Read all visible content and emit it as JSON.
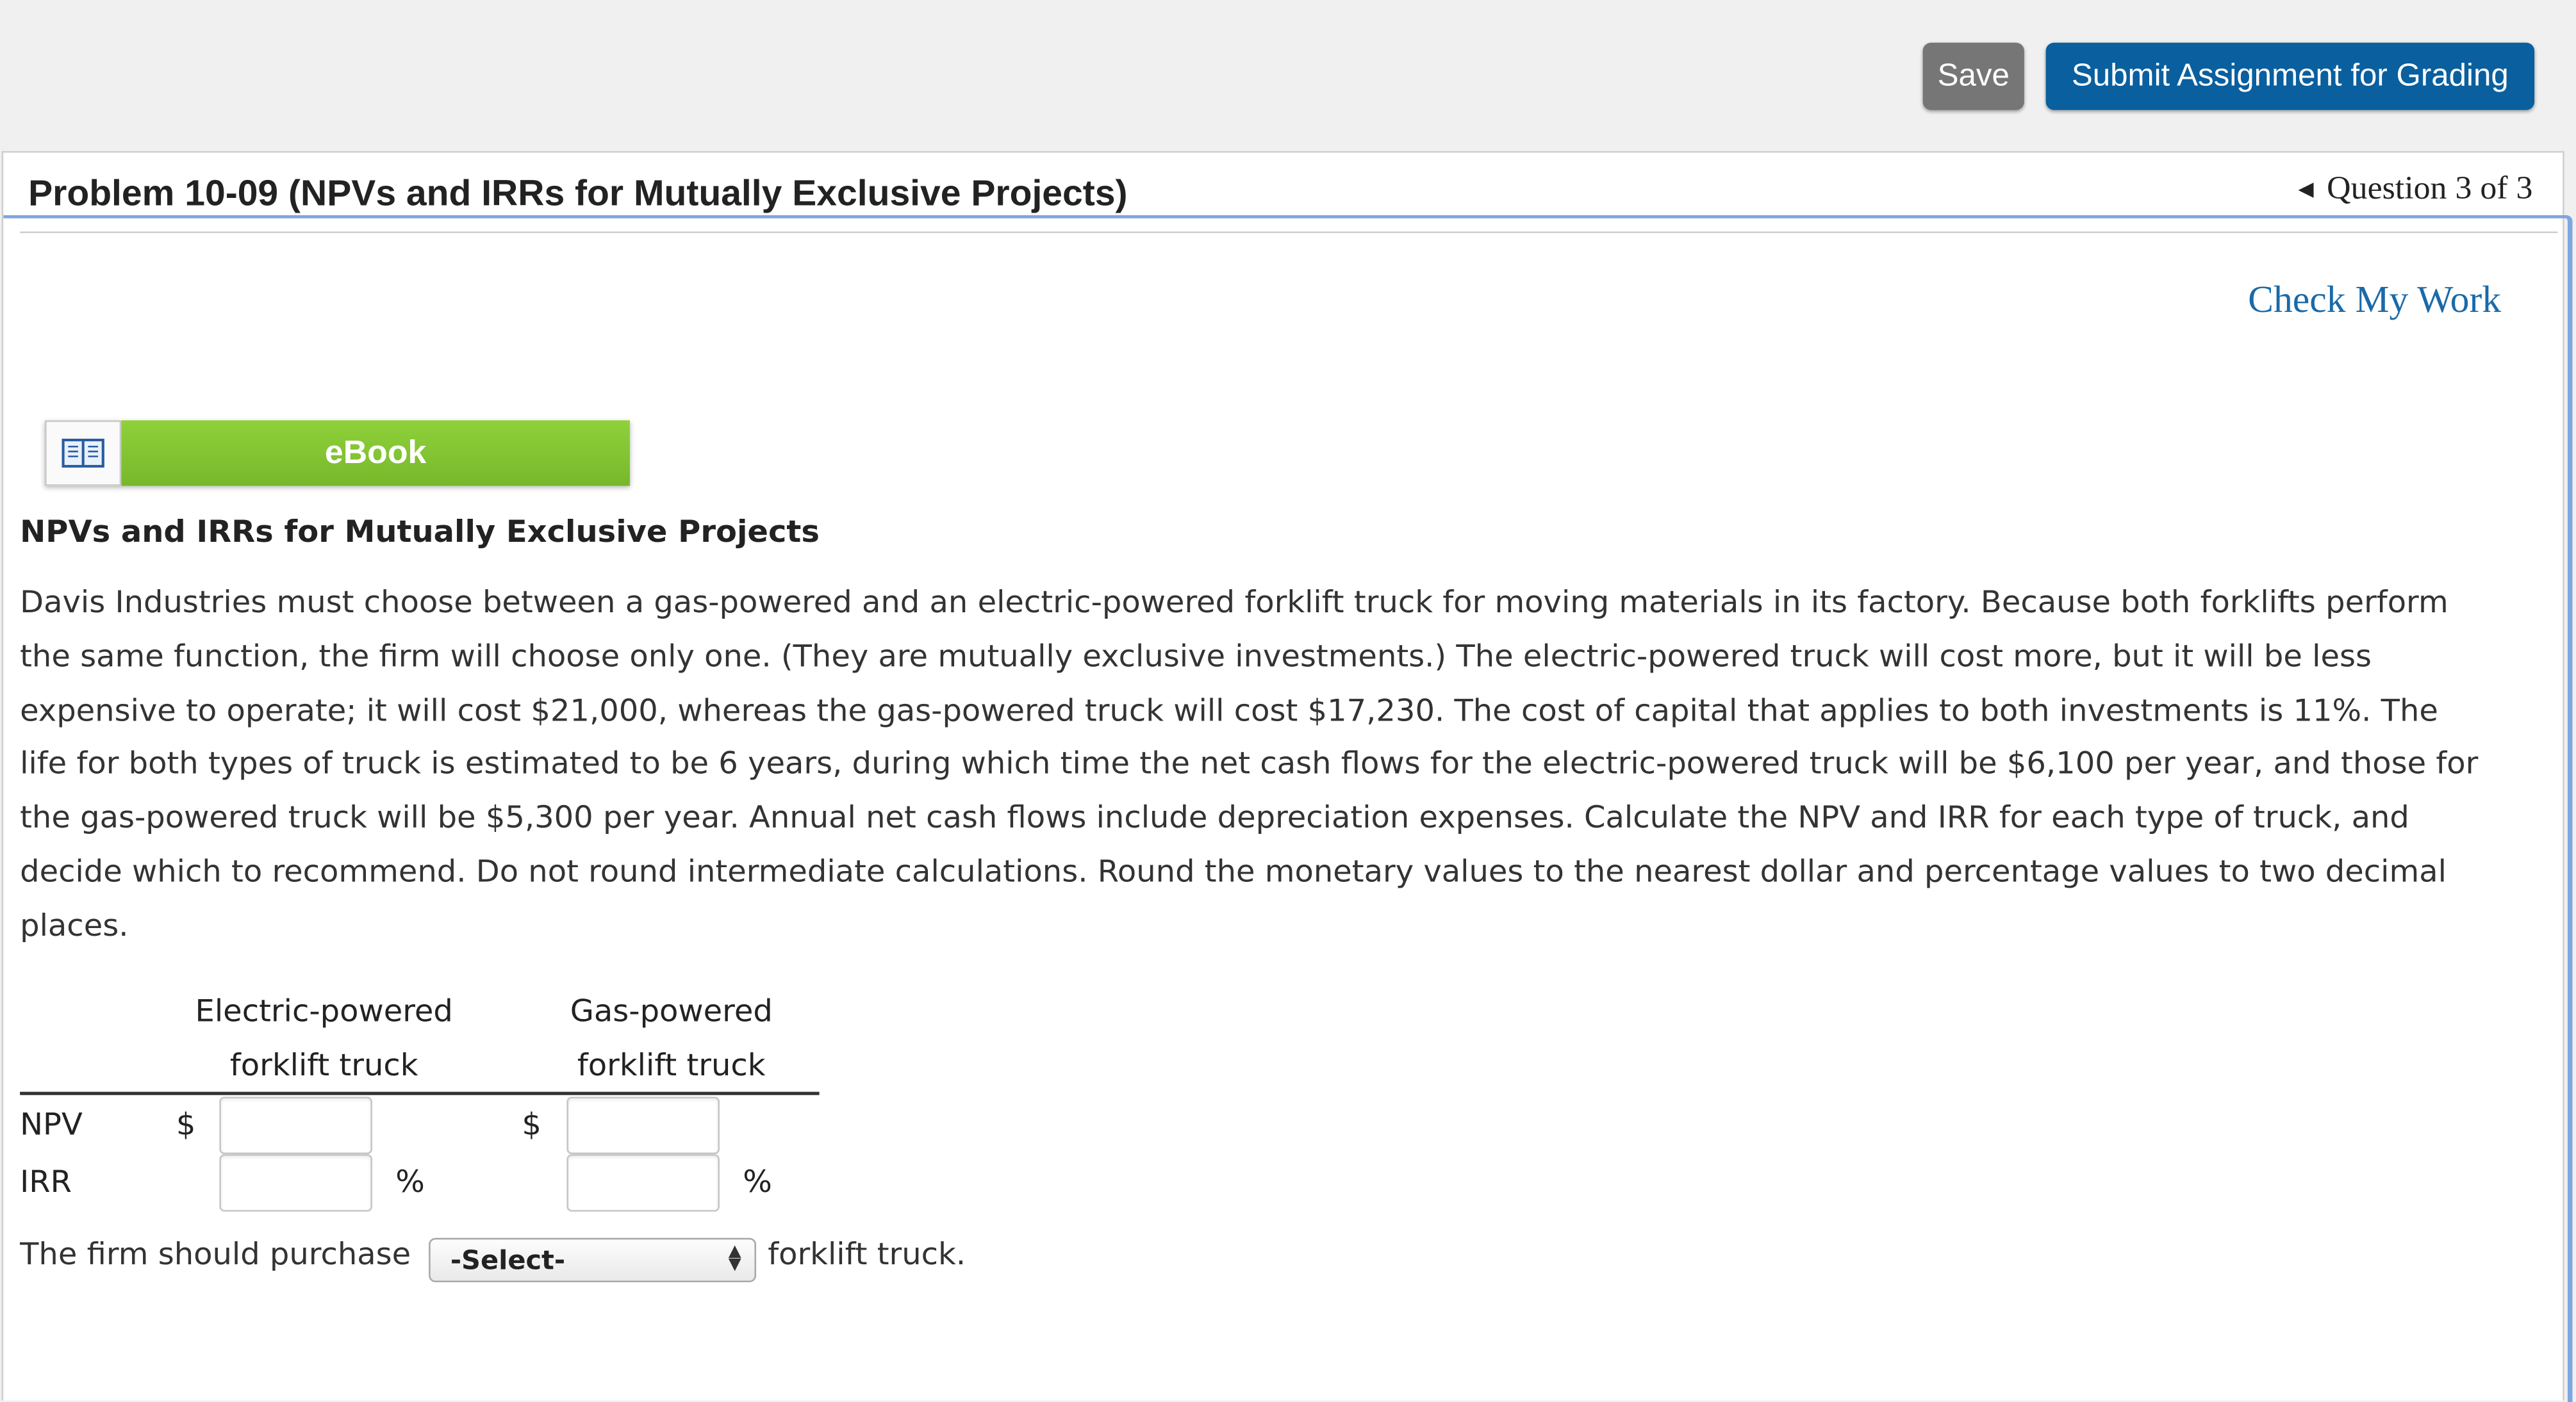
{
  "toolbar": {
    "save_label": "Save",
    "submit_label": "Submit Assignment for Grading"
  },
  "header": {
    "problem_title": "Problem 10-09 (NPVs and IRRs for Mutually Exclusive Projects)",
    "question_nav": "Question 3 of 3"
  },
  "check_my_work": "Check My Work",
  "ebook": {
    "label": "eBook",
    "icon": "book-icon"
  },
  "problem": {
    "title": "NPVs and IRRs for Mutually Exclusive Projects",
    "lines": [
      "Davis Industries must choose between a gas-powered and an electric-powered forklift truck for moving materials in its factory. Because both forklifts perform",
      "the same function, the firm will choose only one. (They are mutually exclusive investments.) The electric-powered truck will cost more, but it will be less",
      "expensive to operate; it will cost $21,000, whereas the gas-powered truck will cost $17,230. The cost of capital that applies to both investments is 11%. The",
      "life for both types of truck is estimated to be 6 years, during which time the net cash flows for the electric-powered truck will be $6,100 per year, and those for",
      "the gas-powered truck will be $5,300 per year. Annual net cash flows include depreciation expenses. Calculate the NPV and IRR for each type of truck, and",
      "decide which to recommend. Do not round intermediate calculations. Round the monetary values to the nearest dollar and percentage values to two decimal",
      "places."
    ]
  },
  "table": {
    "col1_line1": "Electric-powered",
    "col1_line2": "forklift truck",
    "col2_line1": "Gas-powered",
    "col2_line2": "forklift truck",
    "row_npv": "NPV",
    "row_irr": "IRR",
    "currency": "$",
    "percent": "%",
    "npv_electric": "",
    "npv_gas": "",
    "irr_electric": "",
    "irr_gas": ""
  },
  "recommendation": {
    "prefix": "The firm should purchase",
    "select_value": "-Select-",
    "suffix": "forklift truck."
  },
  "colors": {
    "submit_blue": "#0a5f9e",
    "save_gray": "#767676",
    "ebook_green": "#7fc031",
    "link_blue": "#1a6aa8",
    "focus_blue": "#7ea6e0"
  }
}
